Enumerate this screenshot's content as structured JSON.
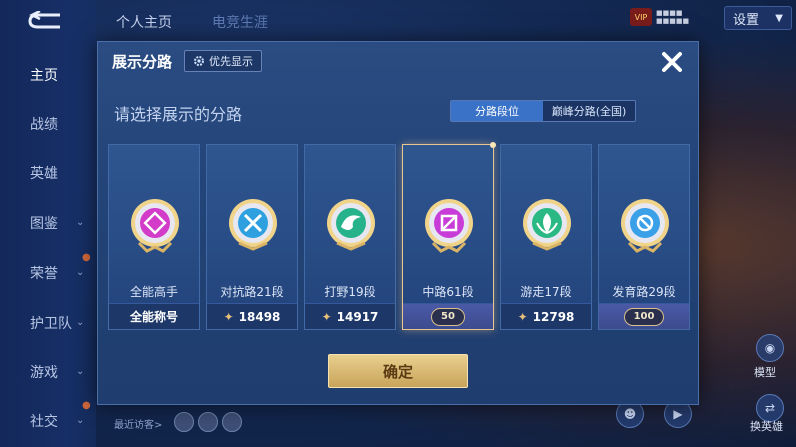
{
  "sidebar": {
    "items": [
      {
        "label": "主页",
        "active": true
      },
      {
        "label": "战绩"
      },
      {
        "label": "英雄"
      },
      {
        "label": "图鉴"
      },
      {
        "label": "荣誉"
      },
      {
        "label": "护卫队"
      },
      {
        "label": "游戏"
      },
      {
        "label": "社交"
      }
    ]
  },
  "top": {
    "tab_profile": "个人主页",
    "tab_other": "电竞生涯",
    "vip_label": "VIP",
    "settings_label": "设置"
  },
  "right": {
    "model_label": "模型",
    "swap_label": "换英雄"
  },
  "bottom": {
    "recent_label": "最近访客>"
  },
  "dialog": {
    "title": "展示分路",
    "priority_label": "优先显示",
    "prompt": "请选择展示的分路",
    "segments": [
      "分路段位",
      "巅峰分路(全国)"
    ],
    "confirm_label": "确定",
    "cards": [
      {
        "name": "全能高手",
        "footer": "全能称号",
        "emblem_color": "#d23cc8"
      },
      {
        "name": "对抗路21段",
        "footer": "18498",
        "emblem_color": "#2ea0e0"
      },
      {
        "name": "打野19段",
        "footer": "14917",
        "emblem_color": "#26b38c"
      },
      {
        "name": "中路61段",
        "footer": "50",
        "emblem_color": "#c83cd8",
        "selected": true
      },
      {
        "name": "游走17段",
        "footer": "12798",
        "emblem_color": "#2ab884"
      },
      {
        "name": "发育路29段",
        "footer": "100",
        "emblem_color": "#3aa0e8"
      }
    ]
  },
  "colors": {
    "accent_gold": "#e6c07a",
    "dialog_bg": "#234478",
    "selected_border": "#e8c690"
  }
}
